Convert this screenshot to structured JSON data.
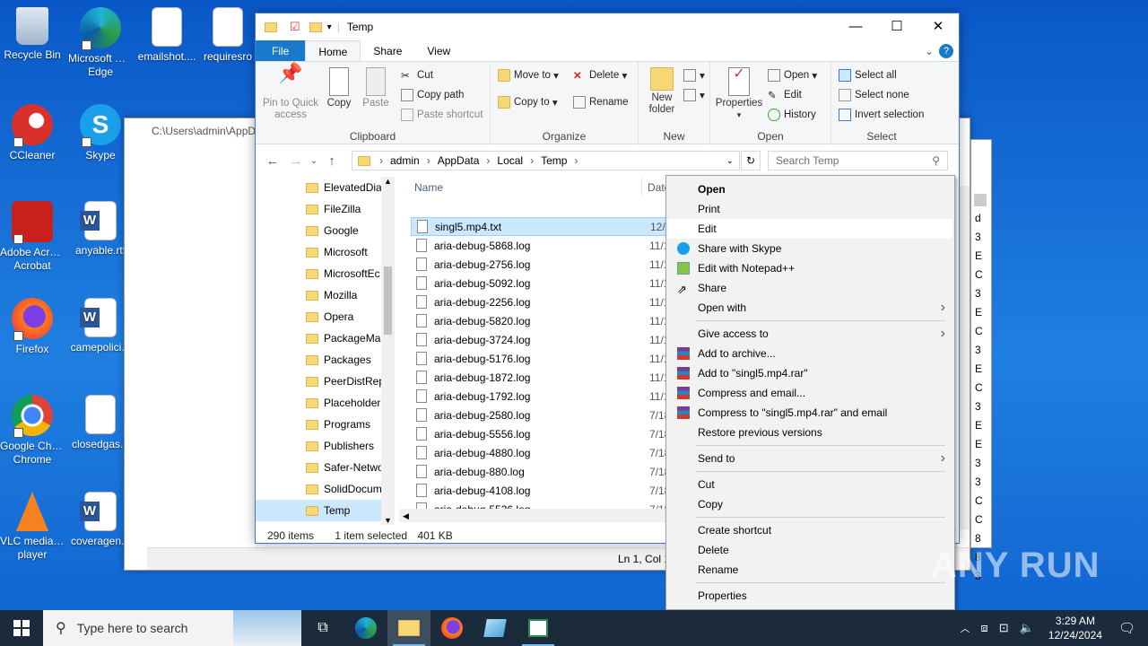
{
  "desktop": {
    "icons": [
      {
        "label": "Recycle Bin"
      },
      {
        "label": "Microsoft Edge"
      },
      {
        "label": "emailshot...."
      },
      {
        "label": "requiresro"
      },
      {
        "label": "CCleaner"
      },
      {
        "label": "Skype"
      },
      {
        "label": "Adobe Acrobat"
      },
      {
        "label": "anyable.rtf"
      },
      {
        "label": "Firefox"
      },
      {
        "label": "camepolici..."
      },
      {
        "label": "Google Chrome"
      },
      {
        "label": "closedgas..."
      },
      {
        "label": "VLC media player"
      },
      {
        "label": "coveragen..."
      }
    ]
  },
  "notepad": {
    "title": "C:\\Users\\admin\\AppD",
    "status": "Ln 1, Col 1",
    "right_chars": [
      "d",
      "3",
      "E",
      "C",
      "3",
      "E",
      "C",
      "3",
      "E",
      "C",
      "3",
      "E",
      "E",
      "3",
      "3",
      "C",
      "C",
      "8",
      "8",
      "3"
    ]
  },
  "explorer": {
    "title": "Temp",
    "tabs": {
      "file": "File",
      "home": "Home",
      "share": "Share",
      "view": "View"
    },
    "ribbon": {
      "clipboard": {
        "pin": "Pin to Quick access",
        "copy": "Copy",
        "paste": "Paste",
        "cut": "Cut",
        "copy_path": "Copy path",
        "paste_shortcut": "Paste shortcut",
        "name": "Clipboard"
      },
      "organize": {
        "move_to": "Move to",
        "copy_to": "Copy to",
        "delete": "Delete",
        "rename": "Rename",
        "name": "Organize"
      },
      "new": {
        "new_folder": "New folder",
        "name": "New"
      },
      "open": {
        "properties": "Properties",
        "open": "Open",
        "edit": "Edit",
        "history": "History",
        "name": "Open"
      },
      "select": {
        "select_all": "Select all",
        "select_none": "Select none",
        "invert": "Invert selection",
        "name": "Select"
      }
    },
    "breadcrumb": [
      "admin",
      "AppData",
      "Local",
      "Temp"
    ],
    "search_placeholder": "Search Temp",
    "nav_items": [
      "ElevatedDia",
      "FileZilla",
      "Google",
      "Microsoft",
      "MicrosoftEc",
      "Mozilla",
      "Opera",
      "PackageMa",
      "Packages",
      "PeerDistRep",
      "Placeholder",
      "Programs",
      "Publishers",
      "Safer-Netwo",
      "SolidDocum",
      "Temp"
    ],
    "column_name": "Name",
    "column_date": "Date",
    "files": [
      {
        "name": "singl5.mp4.txt",
        "date": "12/2"
      },
      {
        "name": "aria-debug-5868.log",
        "date": "11/1"
      },
      {
        "name": "aria-debug-2756.log",
        "date": "11/1"
      },
      {
        "name": "aria-debug-5092.log",
        "date": "11/1"
      },
      {
        "name": "aria-debug-2256.log",
        "date": "11/1"
      },
      {
        "name": "aria-debug-5820.log",
        "date": "11/1"
      },
      {
        "name": "aria-debug-3724.log",
        "date": "11/1"
      },
      {
        "name": "aria-debug-5176.log",
        "date": "11/1"
      },
      {
        "name": "aria-debug-1872.log",
        "date": "11/1"
      },
      {
        "name": "aria-debug-1792.log",
        "date": "11/1"
      },
      {
        "name": "aria-debug-2580.log",
        "date": "7/18"
      },
      {
        "name": "aria-debug-5556.log",
        "date": "7/18"
      },
      {
        "name": "aria-debug-4880.log",
        "date": "7/18"
      },
      {
        "name": "aria-debug-880.log",
        "date": "7/18"
      },
      {
        "name": "aria-debug-4108.log",
        "date": "7/18"
      },
      {
        "name": "aria-debug-5536.log",
        "date": "7/18"
      }
    ],
    "status": {
      "items": "290 items",
      "selected": "1 item selected",
      "size": "401 KB"
    }
  },
  "context_menu": {
    "items": [
      {
        "label": "Open"
      },
      {
        "label": "Print"
      },
      {
        "label": "Edit"
      },
      {
        "label": "Share with Skype"
      },
      {
        "label": "Edit with Notepad++"
      },
      {
        "label": "Share"
      },
      {
        "label": "Open with"
      },
      {
        "label": "Give access to"
      },
      {
        "label": "Add to archive..."
      },
      {
        "label": "Add to \"singl5.mp4.rar\""
      },
      {
        "label": "Compress and email..."
      },
      {
        "label": "Compress to \"singl5.mp4.rar\" and email"
      },
      {
        "label": "Restore previous versions"
      },
      {
        "label": "Send to"
      },
      {
        "label": "Cut"
      },
      {
        "label": "Copy"
      },
      {
        "label": "Create shortcut"
      },
      {
        "label": "Delete"
      },
      {
        "label": "Rename"
      },
      {
        "label": "Properties"
      }
    ]
  },
  "taskbar": {
    "search_placeholder": "Type here to search",
    "time": "3:29 AM",
    "date": "12/24/2024"
  },
  "watermark": "ANY RUN",
  "colors": {
    "accent": "#1979ca",
    "selection": "#cce8ff",
    "taskbar": "#1b2b3c"
  }
}
